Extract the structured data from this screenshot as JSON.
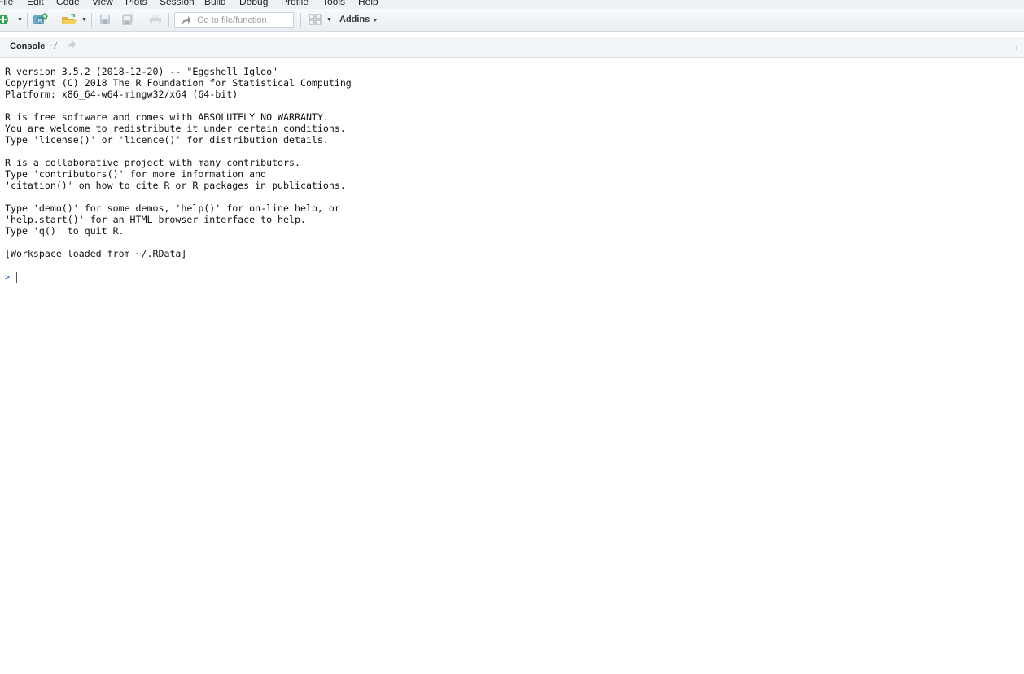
{
  "menu": [
    "File",
    "Edit",
    "Code",
    "View",
    "Plots",
    "Session",
    "Build",
    "Debug",
    "Profile",
    "Tools",
    "Help"
  ],
  "toolbar": {
    "goto_placeholder": "Go to file/function",
    "addins_label": "Addins"
  },
  "console_tab": {
    "title": "Console",
    "path": "~/"
  },
  "console_lines": [
    "R version 3.5.2 (2018-12-20) -- \"Eggshell Igloo\"",
    "Copyright (C) 2018 The R Foundation for Statistical Computing",
    "Platform: x86_64-w64-mingw32/x64 (64-bit)",
    "",
    "R is free software and comes with ABSOLUTELY NO WARRANTY.",
    "You are welcome to redistribute it under certain conditions.",
    "Type 'license()' or 'licence()' for distribution details.",
    "",
    "R is a collaborative project with many contributors.",
    "Type 'contributors()' for more information and",
    "'citation()' on how to cite R or R packages in publications.",
    "",
    "Type 'demo()' for some demos, 'help()' for on-line help, or",
    "'help.start()' for an HTML browser interface to help.",
    "Type 'q()' to quit R.",
    "",
    "[Workspace loaded from ~/.RData]"
  ],
  "prompt": ">"
}
